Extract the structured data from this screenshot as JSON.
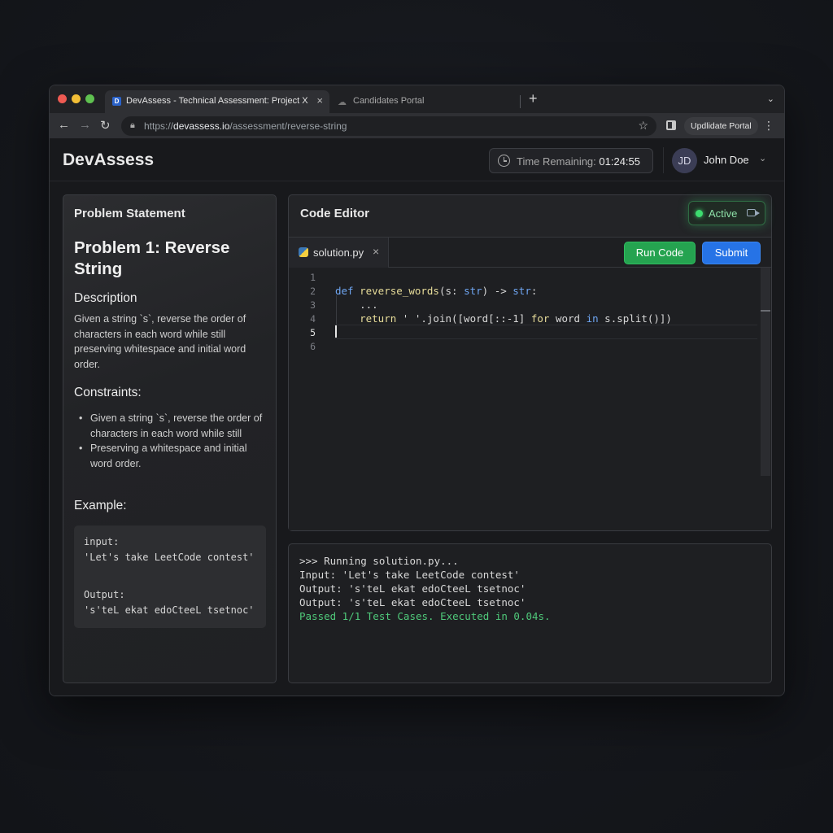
{
  "browser": {
    "active_tab": {
      "favicon": "D",
      "title": "DevAssess - Technical Assessment: Project X",
      "close": "×"
    },
    "inactive_tab": {
      "icon": "cloud-icon",
      "title": "Candidates Portal"
    },
    "new_tab": "+",
    "tab_menu": "⌄",
    "nav": {
      "back": "←",
      "forward": "→",
      "reload": "↻"
    },
    "url": {
      "scheme": "https://",
      "host": "devassess.io",
      "path": "/assessment/reverse-string"
    },
    "bookmark": "☆",
    "update_label": "Updlidate Portal",
    "menu": "⋮"
  },
  "app": {
    "logo": "DevAssess",
    "timer": {
      "label": "Time Remaining: ",
      "value": "01:24:55"
    },
    "user": {
      "initials": "JD",
      "name": "John Doe",
      "chevron": "⌄"
    }
  },
  "problem": {
    "header": "Problem Statement",
    "title": "Problem 1: Reverse String",
    "description_heading": "Description",
    "description": "Given a string `s`, reverse the order of characters in each word while still preserving whitespace and initial word order.",
    "constraints_heading": "Constraints:",
    "constraints": [
      "Given a string `s`, reverse the order of characters in each word while still",
      "Preserving a whitespace and initial word order."
    ],
    "example_heading": "Example:",
    "example": {
      "input_label": "input:",
      "input_value": "'Let's take LeetCode contest'",
      "output_label": "Output:",
      "output_value": "'s'teL ekat edoCteeL tsetnoc'"
    }
  },
  "editor": {
    "header": "Code Editor",
    "status": "Active",
    "file_name": "solution.py",
    "file_close": "×",
    "run_label": "Run Code",
    "submit_label": "Submit",
    "line_numbers": [
      "1",
      "2",
      "3",
      "4",
      "5",
      "6"
    ],
    "code": {
      "line2": {
        "kw": "def",
        "fn": "reverse_words",
        "p1": "(s: ",
        "t1": "str",
        "p2": ") -> ",
        "t2": "str",
        "p3": ":"
      },
      "line3": "    ...",
      "line4": {
        "indent": "    ",
        "kw1": "return",
        "p1": " ' '.join([word[::-1] ",
        "kw2": "for",
        "p2": " word ",
        "kw3": "in",
        "p3": " s.split()])"
      }
    }
  },
  "console": {
    "lines": [
      ">>> Running solution.py...",
      "Input: 'Let's take LeetCode contest'",
      "Output: 's'teL ekat edoCteeL tsetnoc'",
      "Output: 's'teL ekat edoCteeL tsetnoc'",
      "Passed 1/1 Test Cases. Executed in 0.04s."
    ]
  },
  "colors": {
    "accent_green": "#25a350",
    "accent_blue": "#2673e6",
    "status_active": "#3ddc6f",
    "pass_text": "#4fc97a"
  }
}
